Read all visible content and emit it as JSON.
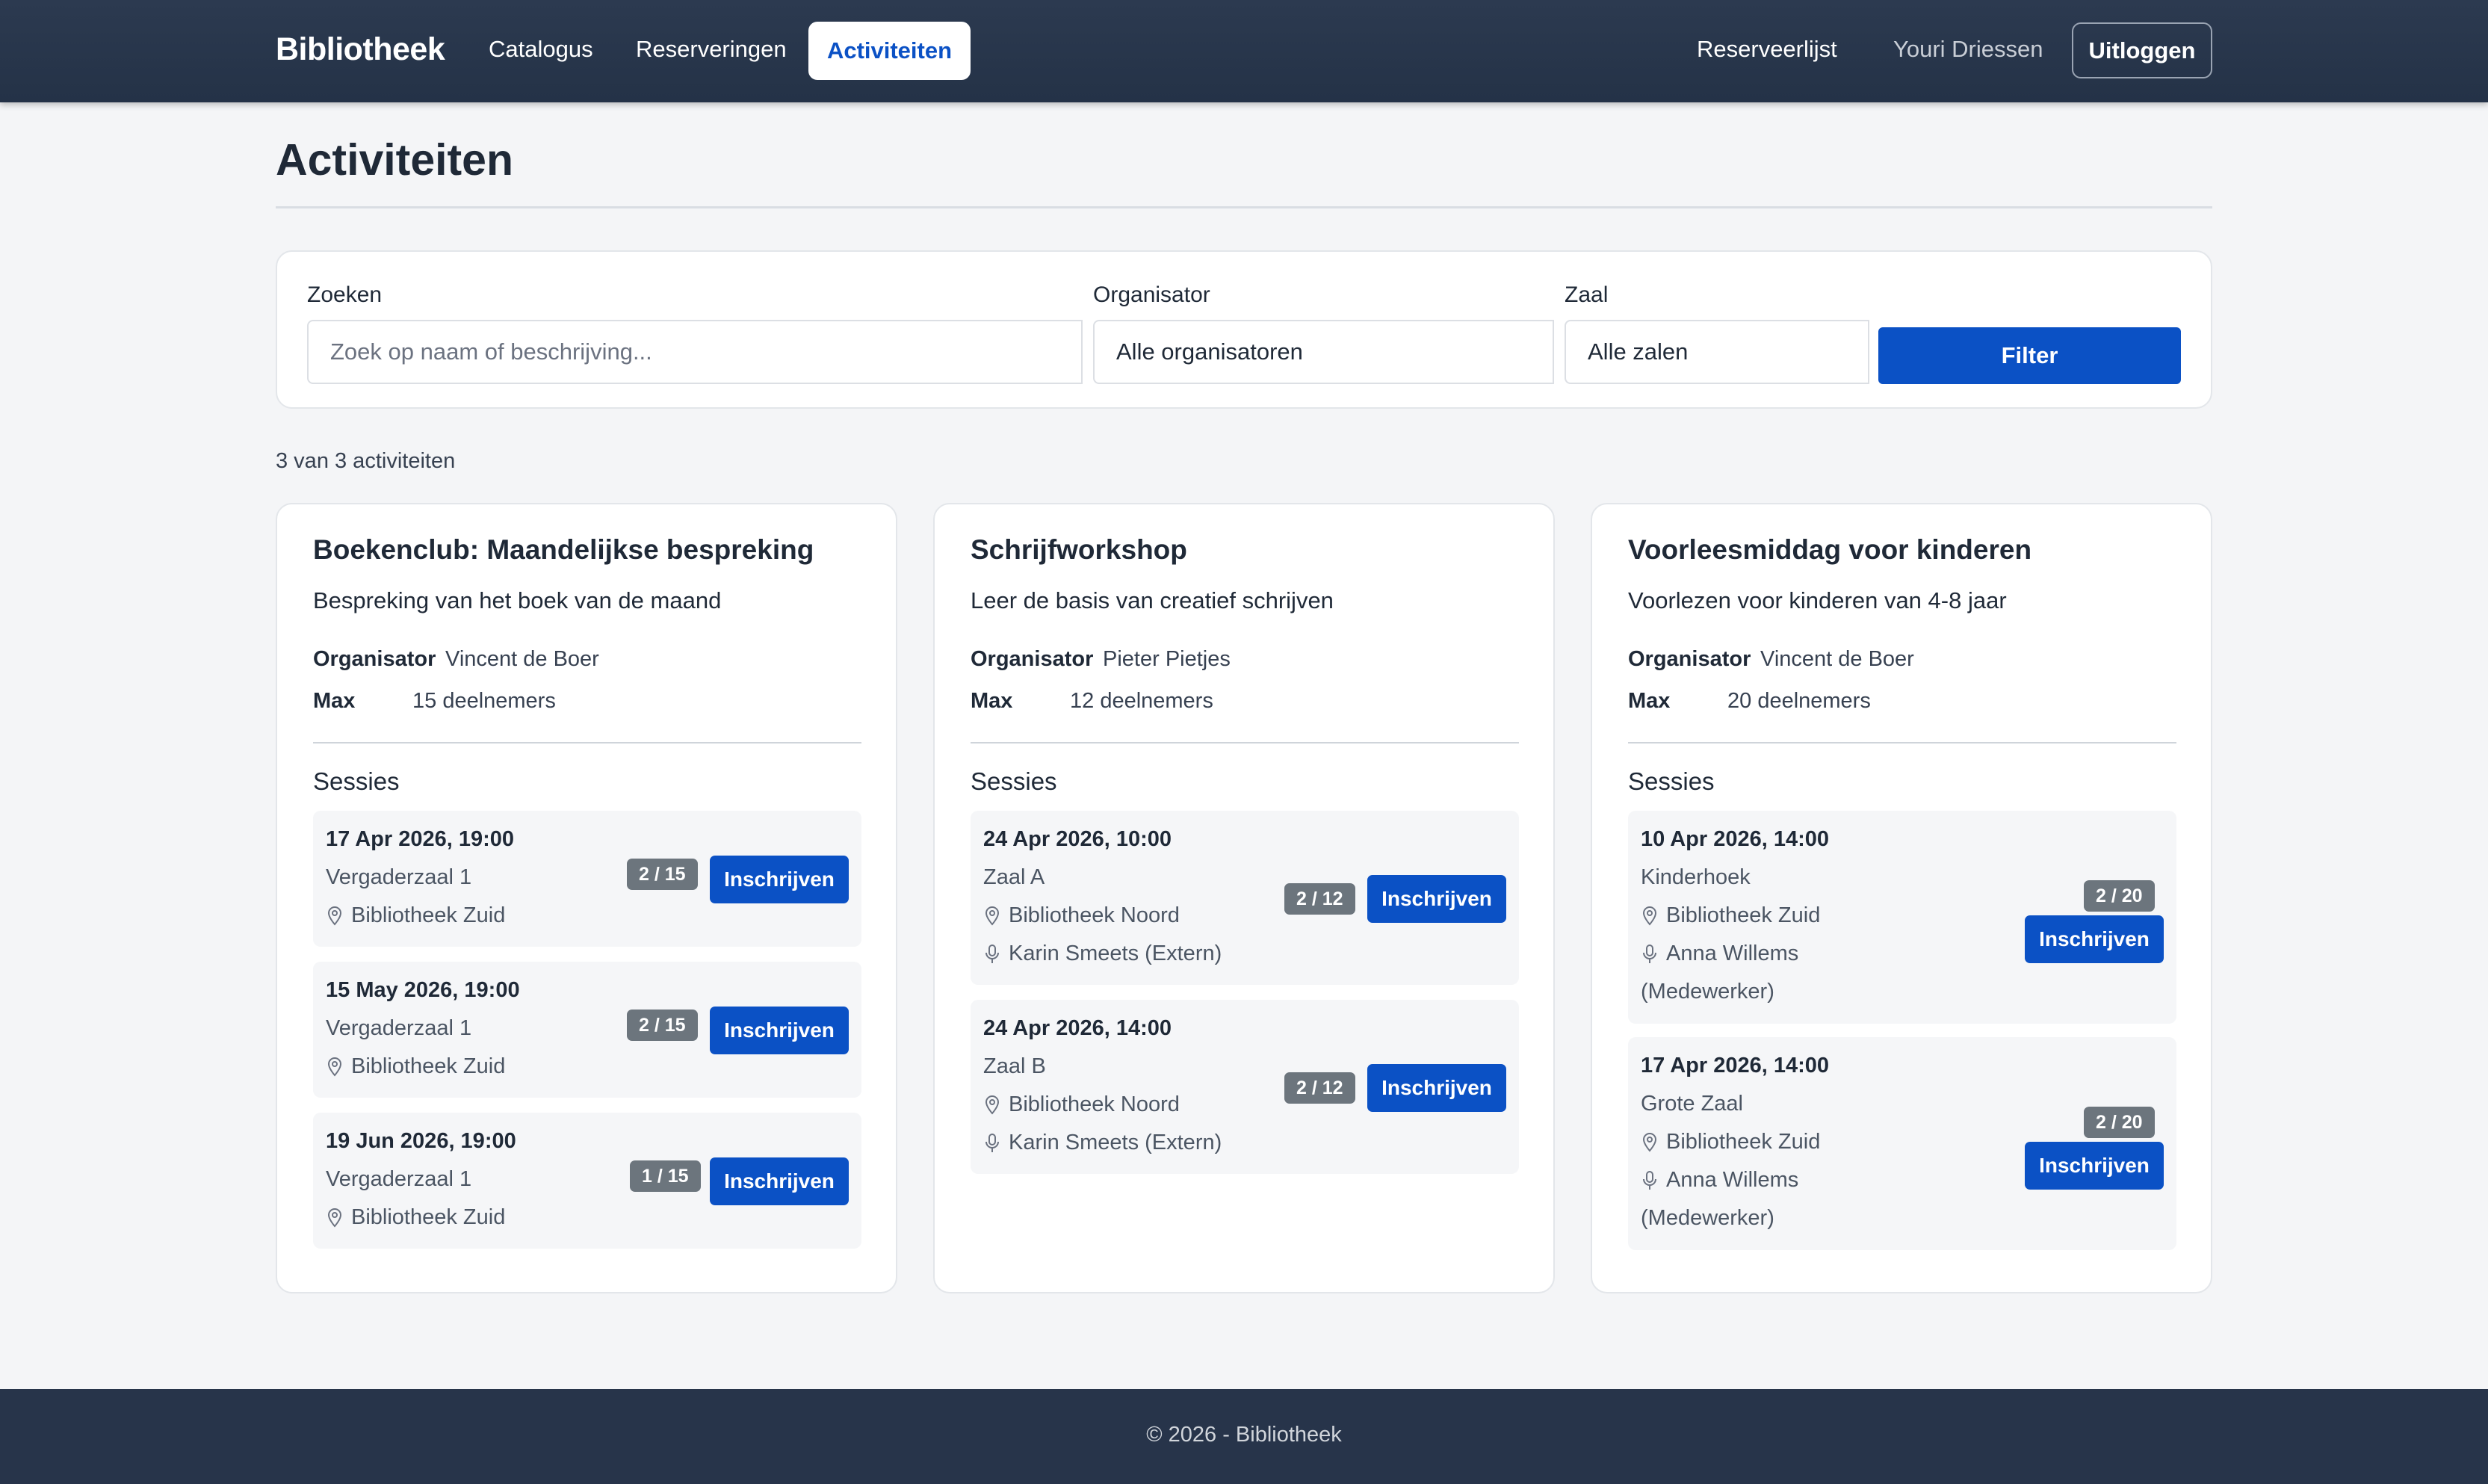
{
  "navbar": {
    "brand": "Bibliotheek",
    "links": [
      "Catalogus",
      "Reserveringen"
    ],
    "active_link": "Activiteiten",
    "reserve_list": "Reserveerlijst",
    "user_name": "Youri Driessen",
    "logout": "Uitloggen"
  },
  "page": {
    "title": "Activiteiten",
    "count_text": "3 van 3 activiteiten"
  },
  "filters": {
    "search_label": "Zoeken",
    "search_placeholder": "Zoek op naam of beschrijving...",
    "organizer_label": "Organisator",
    "organizer_value": "Alle organisatoren",
    "room_label": "Zaal",
    "room_value": "Alle zalen",
    "filter_button": "Filter"
  },
  "labels": {
    "organizer": "Organisator",
    "max": "Max",
    "sessions": "Sessies",
    "signup": "Inschrijven"
  },
  "activities": [
    {
      "title": "Boekenclub: Maandelijkse bespreking",
      "description": "Bespreking van het boek van de maand",
      "organizer": "Vincent de Boer",
      "max": "15 deelnemers",
      "sessions": [
        {
          "date": "17 Apr 2026, 19:00",
          "room": "Vergaderzaal 1",
          "location": "Bibliotheek Zuid",
          "capacity": "2 / 15"
        },
        {
          "date": "15 May 2026, 19:00",
          "room": "Vergaderzaal 1",
          "location": "Bibliotheek Zuid",
          "capacity": "2 / 15"
        },
        {
          "date": "19 Jun 2026, 19:00",
          "room": "Vergaderzaal 1",
          "location": "Bibliotheek Zuid",
          "capacity": "1 / 15"
        }
      ]
    },
    {
      "title": "Schrijfworkshop",
      "description": "Leer de basis van creatief schrijven",
      "organizer": "Pieter Pietjes",
      "max": "12 deelnemers",
      "sessions": [
        {
          "date": "24 Apr 2026, 10:00",
          "room": "Zaal A",
          "location": "Bibliotheek Noord",
          "speaker": "Karin Smeets (Extern)",
          "capacity": "2 / 12"
        },
        {
          "date": "24 Apr 2026, 14:00",
          "room": "Zaal B",
          "location": "Bibliotheek Noord",
          "speaker": "Karin Smeets (Extern)",
          "capacity": "2 / 12"
        }
      ]
    },
    {
      "title": "Voorleesmiddag voor kinderen",
      "description": "Voorlezen voor kinderen van 4-8 jaar",
      "organizer": "Vincent de Boer",
      "max": "20 deelnemers",
      "sessions": [
        {
          "date": "10 Apr 2026, 14:00",
          "room": "Kinderhoek",
          "location": "Bibliotheek Zuid",
          "speaker": "Anna Willems",
          "speaker_role": "(Medewerker)",
          "capacity": "2 / 20"
        },
        {
          "date": "17 Apr 2026, 14:00",
          "room": "Grote Zaal",
          "location": "Bibliotheek Zuid",
          "speaker": "Anna Willems",
          "speaker_role": "(Medewerker)",
          "capacity": "2 / 20"
        }
      ]
    }
  ],
  "footer": {
    "text": "© 2026 - Bibliotheek"
  },
  "colors": {
    "navbar": "#243247",
    "primary": "#0b51c5",
    "badge": "#6c757d",
    "footer": "#27344a"
  },
  "icons": [
    "map-pin-icon",
    "microphone-icon"
  ]
}
